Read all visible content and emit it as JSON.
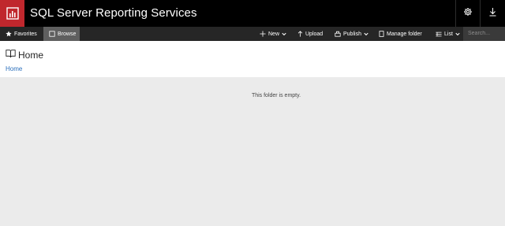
{
  "header": {
    "app_title": "SQL Server Reporting Services",
    "icons": [
      "reporting-logo-icon",
      "gear-icon",
      "download-icon"
    ],
    "colors": {
      "header_bg": "#000000",
      "logo_bg": "#c0272d"
    }
  },
  "toolbar": {
    "favorites_label": "Favorites",
    "browse_label": "Browse",
    "new_label": "New",
    "upload_label": "Upload",
    "publish_label": "Publish",
    "manage_folder_label": "Manage folder",
    "list_label": "List",
    "search_placeholder": "Search..."
  },
  "page": {
    "title": "Home",
    "breadcrumb": "Home",
    "empty_message": "This folder is empty."
  }
}
